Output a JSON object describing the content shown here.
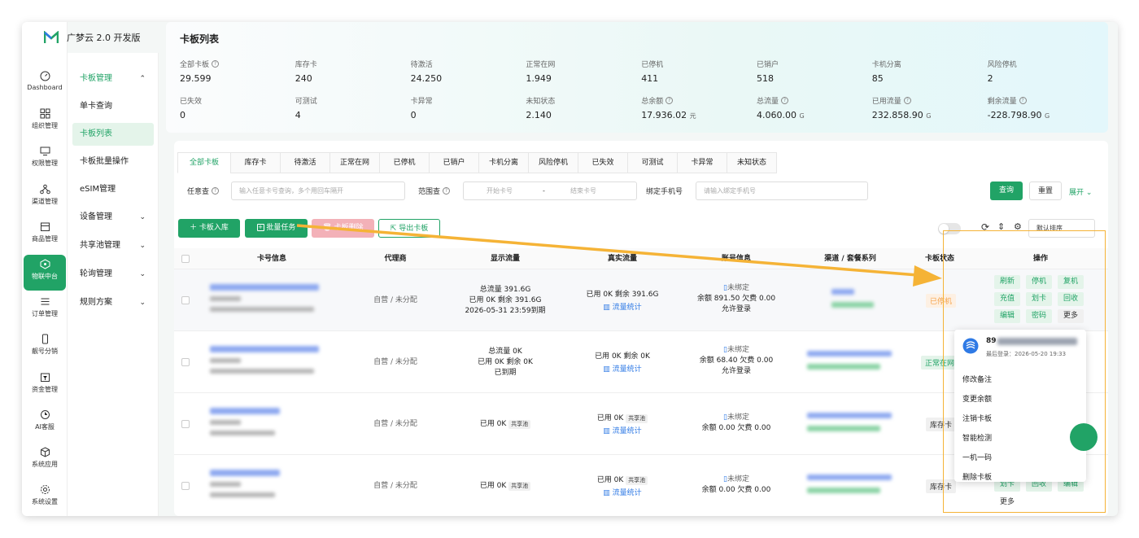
{
  "app": {
    "brand": "广梦云 2.0 开发版",
    "accent": "#21a366"
  },
  "rail": [
    {
      "label": "Dashboard",
      "icon": "dashboard-icon"
    },
    {
      "label": "组织管理",
      "icon": "org-icon"
    },
    {
      "label": "权限管理",
      "icon": "monitor-icon"
    },
    {
      "label": "渠道管理",
      "icon": "channel-icon"
    },
    {
      "label": "商品管理",
      "icon": "shop-icon"
    },
    {
      "label": "物联中台",
      "icon": "iot-icon",
      "active": true
    },
    {
      "label": "订单管理",
      "icon": "list-icon"
    },
    {
      "label": "靓号分销",
      "icon": "phone-icon"
    },
    {
      "label": "资金管理",
      "icon": "wallet-icon"
    },
    {
      "label": "AI客服",
      "icon": "ai-icon"
    },
    {
      "label": "系统应用",
      "icon": "cube-icon"
    },
    {
      "label": "系统设置",
      "icon": "gear-icon"
    }
  ],
  "submenu": [
    {
      "label": "卡板管理",
      "chev": "⌃",
      "group": true
    },
    {
      "label": "单卡查询"
    },
    {
      "label": "卡板列表",
      "active": true
    },
    {
      "label": "卡板批量操作"
    },
    {
      "label": "eSIM管理"
    },
    {
      "label": "设备管理",
      "chev": "⌄"
    },
    {
      "label": "共享池管理",
      "chev": "⌄"
    },
    {
      "label": "轮询管理",
      "chev": "⌄"
    },
    {
      "label": "规则方案",
      "chev": "⌄"
    }
  ],
  "page_title": "卡板列表",
  "stats": [
    {
      "label": "全部卡板",
      "value": "29.599",
      "help": true
    },
    {
      "label": "库存卡",
      "value": "240"
    },
    {
      "label": "待激活",
      "value": "24.250"
    },
    {
      "label": "正常在网",
      "value": "1.949"
    },
    {
      "label": "已停机",
      "value": "411"
    },
    {
      "label": "已销户",
      "value": "518"
    },
    {
      "label": "卡机分离",
      "value": "85"
    },
    {
      "label": "风险停机",
      "value": "2"
    },
    {
      "label": "已失效",
      "value": "0"
    },
    {
      "label": "可测试",
      "value": "4"
    },
    {
      "label": "卡异常",
      "value": "0"
    },
    {
      "label": "未知状态",
      "value": "2.140"
    },
    {
      "label": "总余额",
      "value": "17.936.02",
      "unit": "元",
      "help": true
    },
    {
      "label": "总流量",
      "value": "4.060.00",
      "unit": "G",
      "help": true
    },
    {
      "label": "已用流量",
      "value": "232.858.90",
      "unit": "G",
      "help": true
    },
    {
      "label": "剩余流量",
      "value": "-228.798.90",
      "unit": "G",
      "help": true
    }
  ],
  "tabs": [
    "全部卡板",
    "库存卡",
    "待激活",
    "正常在网",
    "已停机",
    "已销户",
    "卡机分离",
    "风险停机",
    "已失效",
    "可测试",
    "卡异常",
    "未知状态"
  ],
  "filters": {
    "any_label": "任意查",
    "any_placeholder": "输入任意卡号查询，多个用回车隔开",
    "range_label": "范围查",
    "range_start": "开始卡号",
    "range_sep": "-",
    "range_end": "结束卡号",
    "phone_label": "绑定手机号",
    "phone_placeholder": "请输入绑定手机号",
    "query": "查询",
    "reset": "重置",
    "expand": "展开 ⌄"
  },
  "toolbar": {
    "add": "＋ 卡板入库",
    "batch": "批量任务",
    "delete": "卡板删除",
    "export": "导出卡板",
    "sort": "默认排序"
  },
  "columns": [
    "卡号信息",
    "代理商",
    "显示流量",
    "真实流量",
    "账号信息",
    "渠道 / 套餐系列",
    "卡板状态",
    "操作"
  ],
  "rows": [
    {
      "agent": "自营 / 未分配",
      "display": [
        "总流量 391.6G",
        "已用 0K   剩余 391.6G",
        "2026-05-31 23:59到期"
      ],
      "real": [
        "已用 0K   剩余 391.6G"
      ],
      "real_link": "流量统计",
      "acct": [
        "未绑定",
        "余额 891.50   欠费 0.00",
        "允许登录"
      ],
      "status": "已停机",
      "status_kind": "stopped"
    },
    {
      "agent": "自营 / 未分配",
      "display": [
        "总流量 0K",
        "已用 0K   剩余 0K",
        "已到期"
      ],
      "real": [
        "已用 0K   剩余 0K"
      ],
      "real_link": "流量统计",
      "acct": [
        "未绑定",
        "余额 68.40   欠费 0.00",
        "允许登录"
      ],
      "status": "正常在网",
      "status_kind": "normal"
    },
    {
      "agent": "自营 / 未分配",
      "display": [
        "已用 0K"
      ],
      "display_tag": "共享池",
      "real": [
        "已用 0K"
      ],
      "real_tag": "共享池",
      "real_link": "流量统计",
      "acct": [
        "未绑定",
        "余额 0.00   欠费 0.00"
      ],
      "status": "库存卡",
      "status_kind": "stock"
    },
    {
      "agent": "自营 / 未分配",
      "display": [
        "已用 0K"
      ],
      "display_tag": "共享池",
      "real": [
        "已用 0K"
      ],
      "real_tag": "共享池",
      "real_link": "流量统计",
      "acct": [
        "未绑定",
        "余额 0.00   欠费 0.00"
      ],
      "status": "库存卡",
      "status_kind": "stock"
    }
  ],
  "ops_row1": [
    "刷新",
    "停机",
    "复机",
    "充值",
    "划卡",
    "回收",
    "编辑",
    "密码",
    "更多"
  ],
  "ops_row4": [
    "划卡",
    "回收",
    "编辑",
    "更多"
  ],
  "dropdown": {
    "number": "89",
    "last_login": "最后登录：2026-05-20 19:33",
    "items": [
      "修改备注",
      "变更余额",
      "注销卡板",
      "智能检测",
      "一机一码",
      "删除卡板"
    ]
  }
}
